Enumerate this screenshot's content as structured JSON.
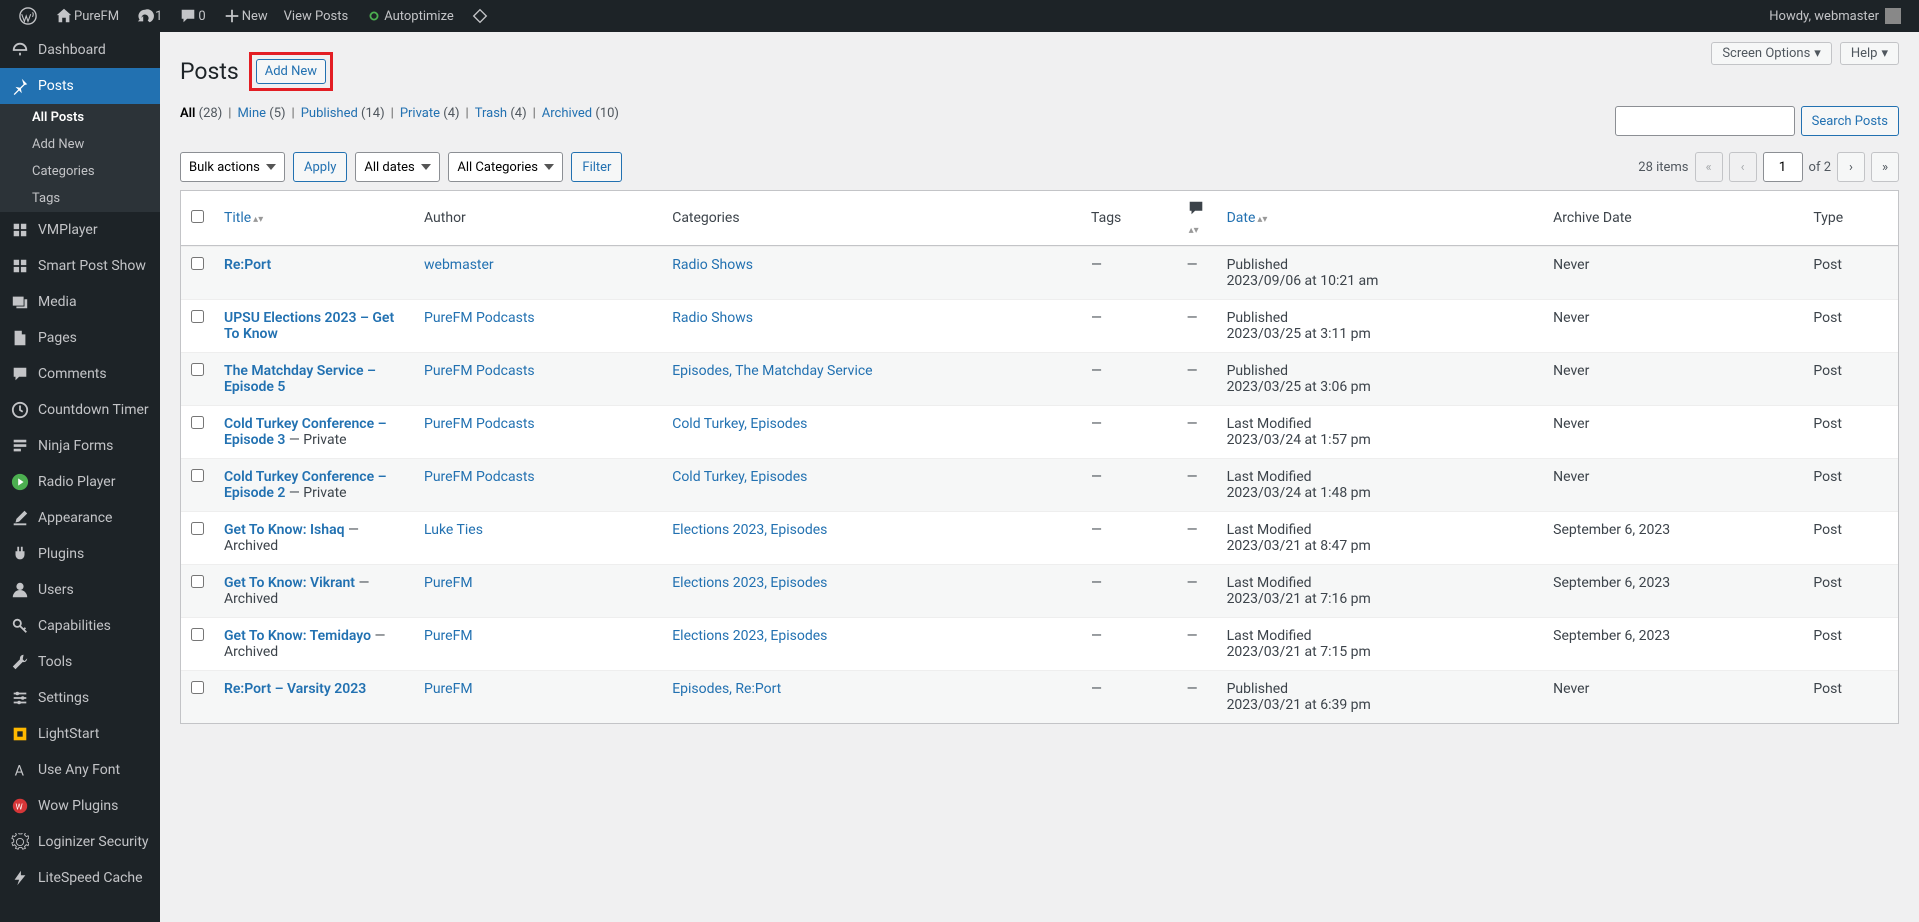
{
  "adminbar": {
    "site_name": "PureFM",
    "updates": "1",
    "comments": "0",
    "new_label": "New",
    "view_posts": "View Posts",
    "autoptimize": "Autoptimize",
    "howdy": "Howdy, webmaster"
  },
  "sidebar": {
    "items": [
      {
        "label": "Dashboard",
        "icon": "dashboard"
      },
      {
        "label": "Posts",
        "icon": "pin",
        "current": true,
        "submenu": [
          {
            "label": "All Posts",
            "current": true
          },
          {
            "label": "Add New"
          },
          {
            "label": "Categories"
          },
          {
            "label": "Tags"
          }
        ]
      },
      {
        "label": "VMPlayer",
        "icon": "grid"
      },
      {
        "label": "Smart Post Show",
        "icon": "grid"
      },
      {
        "label": "Media",
        "icon": "media"
      },
      {
        "label": "Pages",
        "icon": "page"
      },
      {
        "label": "Comments",
        "icon": "comment"
      },
      {
        "label": "Countdown Timer",
        "icon": "clock"
      },
      {
        "label": "Ninja Forms",
        "icon": "form"
      },
      {
        "label": "Radio Player",
        "icon": "play"
      },
      {
        "label": "Appearance",
        "icon": "brush"
      },
      {
        "label": "Plugins",
        "icon": "plug"
      },
      {
        "label": "Users",
        "icon": "user"
      },
      {
        "label": "Capabilities",
        "icon": "key"
      },
      {
        "label": "Tools",
        "icon": "wrench"
      },
      {
        "label": "Settings",
        "icon": "sliders"
      },
      {
        "label": "LightStart",
        "icon": "lightstart"
      },
      {
        "label": "Use Any Font",
        "icon": "font"
      },
      {
        "label": "Wow Plugins",
        "icon": "wow"
      },
      {
        "label": "Loginizer Security",
        "icon": "gear"
      },
      {
        "label": "LiteSpeed Cache",
        "icon": "bolt"
      }
    ]
  },
  "page": {
    "title": "Posts",
    "add_new": "Add New",
    "screen_options": "Screen Options",
    "help": "Help"
  },
  "filters": {
    "views": [
      {
        "label": "All",
        "count": "(28)",
        "current": true
      },
      {
        "label": "Mine",
        "count": "(5)"
      },
      {
        "label": "Published",
        "count": "(14)"
      },
      {
        "label": "Private",
        "count": "(4)"
      },
      {
        "label": "Trash",
        "count": "(4)"
      },
      {
        "label": "Archived",
        "count": "(10)"
      }
    ],
    "bulk_actions": "Bulk actions",
    "apply": "Apply",
    "all_dates": "All dates",
    "all_categories": "All Categories",
    "filter": "Filter",
    "search": "Search Posts"
  },
  "pagination": {
    "items_label": "28 items",
    "current": "1",
    "of_label": "of 2"
  },
  "columns": {
    "title": "Title",
    "author": "Author",
    "categories": "Categories",
    "tags": "Tags",
    "date": "Date",
    "archive_date": "Archive Date",
    "type": "Type"
  },
  "rows": [
    {
      "title": "Re:Port",
      "state": "",
      "author": "webmaster",
      "categories": "Radio Shows",
      "tags": "—",
      "comments": "—",
      "date_status": "Published",
      "date": "2023/09/06 at 10:21 am",
      "archive": "Never",
      "type": "Post"
    },
    {
      "title": "UPSU Elections 2023 – Get To Know",
      "state": "",
      "author": "PureFM Podcasts",
      "categories": "Radio Shows",
      "tags": "—",
      "comments": "—",
      "date_status": "Published",
      "date": "2023/03/25 at 3:11 pm",
      "archive": "Never",
      "type": "Post"
    },
    {
      "title": "The Matchday Service – Episode 5",
      "state": "",
      "author": "PureFM Podcasts",
      "categories": "Episodes, The Matchday Service",
      "tags": "—",
      "comments": "—",
      "date_status": "Published",
      "date": "2023/03/25 at 3:06 pm",
      "archive": "Never",
      "type": "Post"
    },
    {
      "title": "Cold Turkey Conference – Episode 3",
      "state": " — Private",
      "author": "PureFM Podcasts",
      "categories": "Cold Turkey, Episodes",
      "tags": "—",
      "comments": "—",
      "date_status": "Last Modified",
      "date": "2023/03/24 at 1:57 pm",
      "archive": "Never",
      "type": "Post"
    },
    {
      "title": "Cold Turkey Conference – Episode 2",
      "state": " — Private",
      "author": "PureFM Podcasts",
      "categories": "Cold Turkey, Episodes",
      "tags": "—",
      "comments": "—",
      "date_status": "Last Modified",
      "date": "2023/03/24 at 1:48 pm",
      "archive": "Never",
      "type": "Post"
    },
    {
      "title": "Get To Know: Ishaq",
      "state": " — Archived",
      "author": "Luke Ties",
      "categories": "Elections 2023, Episodes",
      "tags": "—",
      "comments": "—",
      "date_status": "Last Modified",
      "date": "2023/03/21 at 8:47 pm",
      "archive": "September 6, 2023",
      "type": "Post"
    },
    {
      "title": "Get To Know: Vikrant",
      "state": " — Archived",
      "author": "PureFM",
      "categories": "Elections 2023, Episodes",
      "tags": "—",
      "comments": "—",
      "date_status": "Last Modified",
      "date": "2023/03/21 at 7:16 pm",
      "archive": "September 6, 2023",
      "type": "Post"
    },
    {
      "title": "Get To Know: Temidayo",
      "state": " — Archived",
      "author": "PureFM",
      "categories": "Elections 2023, Episodes",
      "tags": "—",
      "comments": "—",
      "date_status": "Last Modified",
      "date": "2023/03/21 at 7:15 pm",
      "archive": "September 6, 2023",
      "type": "Post"
    },
    {
      "title": "Re:Port – Varsity 2023",
      "state": "",
      "author": "PureFM",
      "categories": "Episodes, Re:Port",
      "tags": "—",
      "comments": "—",
      "date_status": "Published",
      "date": "2023/03/21 at 6:39 pm",
      "archive": "Never",
      "type": "Post"
    }
  ]
}
